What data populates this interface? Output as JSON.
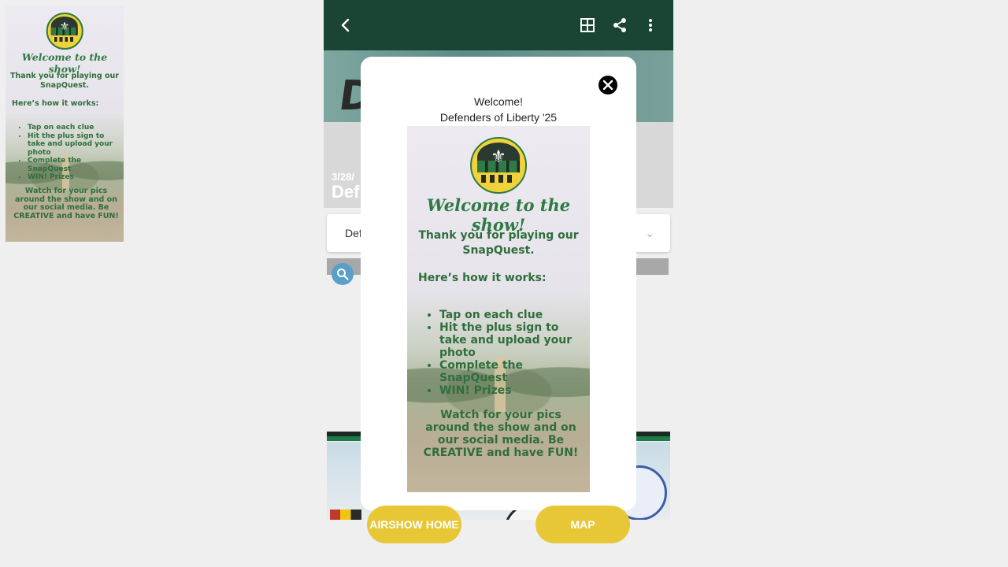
{
  "poster": {
    "welcome": "Welcome to the show!",
    "thanks": "Thank you for playing our SnapQuest.",
    "how": "Here’s how it works:",
    "steps": [
      "Tap on each clue",
      "Hit the plus sign to take and upload your photo",
      "Complete the SnapQuest",
      "WIN! Prizes"
    ],
    "watch": "Watch for your pics around the show and on our social media. Be CREATIVE and have FUN!"
  },
  "header": {
    "icons": [
      "back-arrow-icon",
      "grid-icon",
      "share-icon",
      "more-vert-icon"
    ],
    "color": "#1a4535"
  },
  "event": {
    "date_partial": "3/28/",
    "title_partial": "Def",
    "dropdown_partial": "Def"
  },
  "modal": {
    "title": "Welcome!",
    "subtitle": "Defenders of Liberty '25"
  },
  "buttons": {
    "airshow_home": "AIRSHOW HOME",
    "map": "MAP"
  },
  "colors": {
    "accent": "#e8c736",
    "poster_green": "#2f7a45",
    "search": "#5a9fc9"
  }
}
